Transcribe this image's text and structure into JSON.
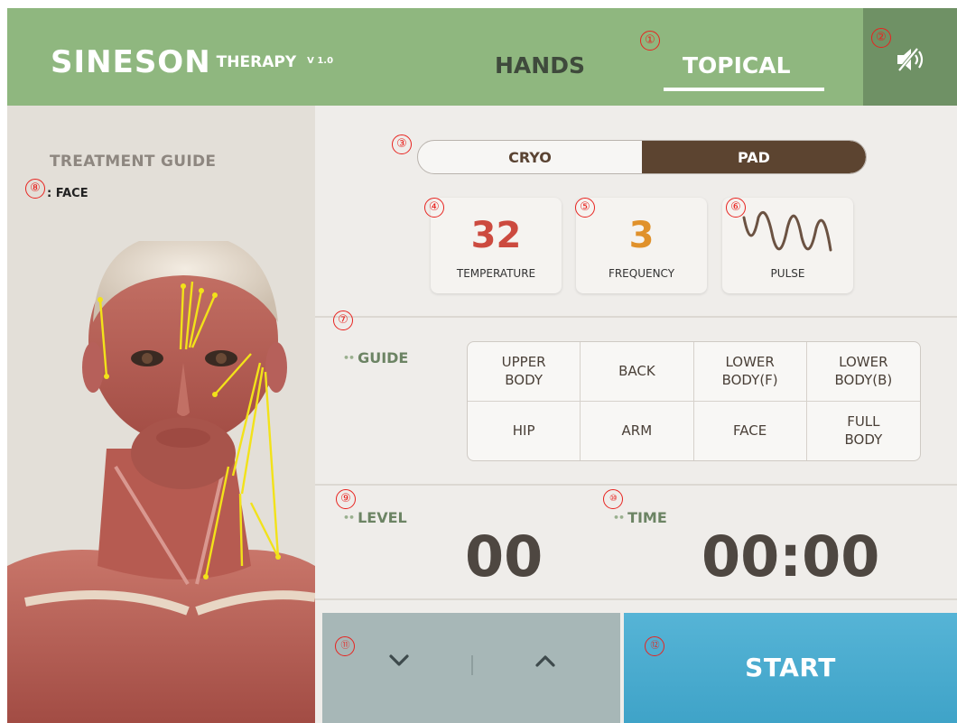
{
  "header": {
    "brand": "SINESON",
    "brand_sub": "THERAPY",
    "version": "V 1.0",
    "tabs": [
      {
        "label": "HANDS",
        "active": false
      },
      {
        "label": "TOPICAL",
        "active": true
      }
    ],
    "sound_icon": "mute-speaker-icon"
  },
  "markers": [
    "①",
    "②",
    "③",
    "④",
    "⑤",
    "⑥",
    "⑦",
    "⑧",
    "⑨",
    "⑩",
    "⑪",
    "⑫"
  ],
  "left": {
    "title": "TREATMENT GUIDE",
    "subtitle": ": FACE"
  },
  "mode": {
    "options": [
      {
        "label": "CRYO",
        "selected": false
      },
      {
        "label": "PAD",
        "selected": true
      }
    ]
  },
  "cards": {
    "temperature": {
      "value": "32",
      "label": "TEMPERATURE"
    },
    "frequency": {
      "value": "3",
      "label": "FREQUENCY"
    },
    "pulse": {
      "label": "PULSE",
      "icon": "pulse-wave-icon"
    }
  },
  "guide": {
    "label": "GUIDE",
    "areas": [
      "UPPER\nBODY",
      "BACK",
      "LOWER\nBODY(F)",
      "LOWER\nBODY(B)",
      "HIP",
      "ARM",
      "FACE",
      "FULL\nBODY"
    ]
  },
  "level": {
    "label": "LEVEL",
    "value": "00"
  },
  "time": {
    "label": "TIME",
    "value": "00:00"
  },
  "controls": {
    "down_icon": "chevron-down-icon",
    "up_icon": "chevron-up-icon"
  },
  "start": {
    "label": "START"
  },
  "colors": {
    "header_green": "#8fb77f",
    "sound_button": "#6f9165",
    "pad_brown": "#5c4430",
    "temperature_red": "#cc4a3f",
    "frequency_orange": "#e0912b",
    "start_blue": "#4aaccf",
    "control_gray": "#a7b7b7",
    "marker_red": "#e8231f"
  }
}
